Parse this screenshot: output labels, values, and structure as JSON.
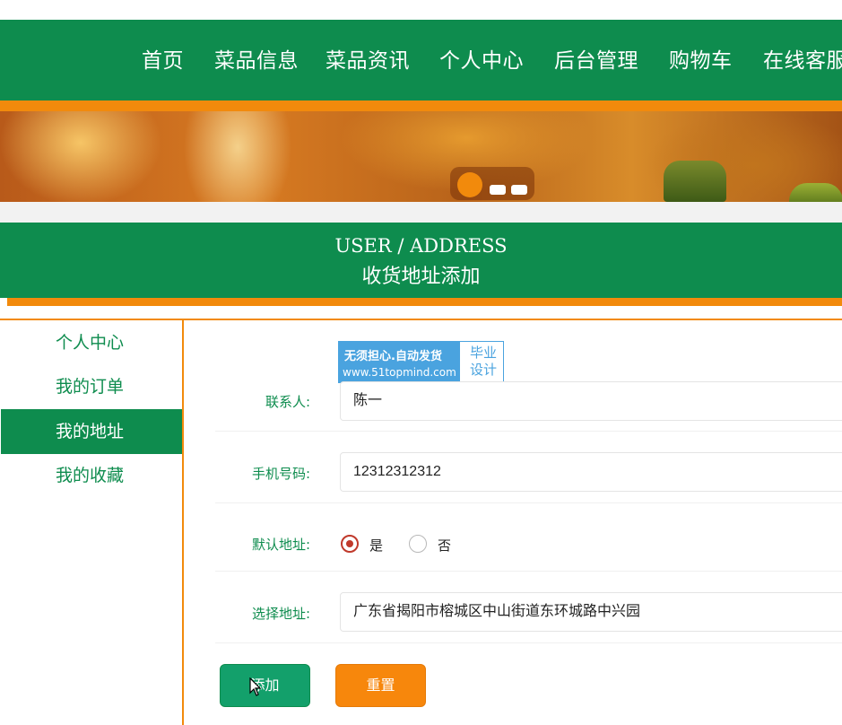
{
  "nav": {
    "items": [
      "首页",
      "菜品信息",
      "菜品资讯",
      "个人中心",
      "后台管理",
      "购物车",
      "在线客服"
    ]
  },
  "section": {
    "title_en": "USER / ADDRESS",
    "title_cn": "收货地址添加"
  },
  "sidebar": {
    "items": [
      "个人中心",
      "我的订单",
      "我的地址",
      "我的收藏"
    ],
    "active": "我的地址"
  },
  "watermark": {
    "line1": "无须担心.自动发货",
    "line2": "www.51topmind.com",
    "right_top": "毕业",
    "right_bottom": "设计"
  },
  "form": {
    "contact_label": "联系人:",
    "contact_value": "陈一",
    "phone_label": "手机号码:",
    "phone_value": "12312312312",
    "default_label": "默认地址:",
    "default_yes": "是",
    "default_no": "否",
    "default_selected": "是",
    "address_label": "选择地址:",
    "address_value": "广东省揭阳市榕城区中山街道东环城路中兴园"
  },
  "buttons": {
    "add": "添加",
    "reset": "重置"
  },
  "colors": {
    "primary_green": "#0e8c4e",
    "accent_orange": "#f28a0c",
    "radio_checked": "#c0392b"
  }
}
